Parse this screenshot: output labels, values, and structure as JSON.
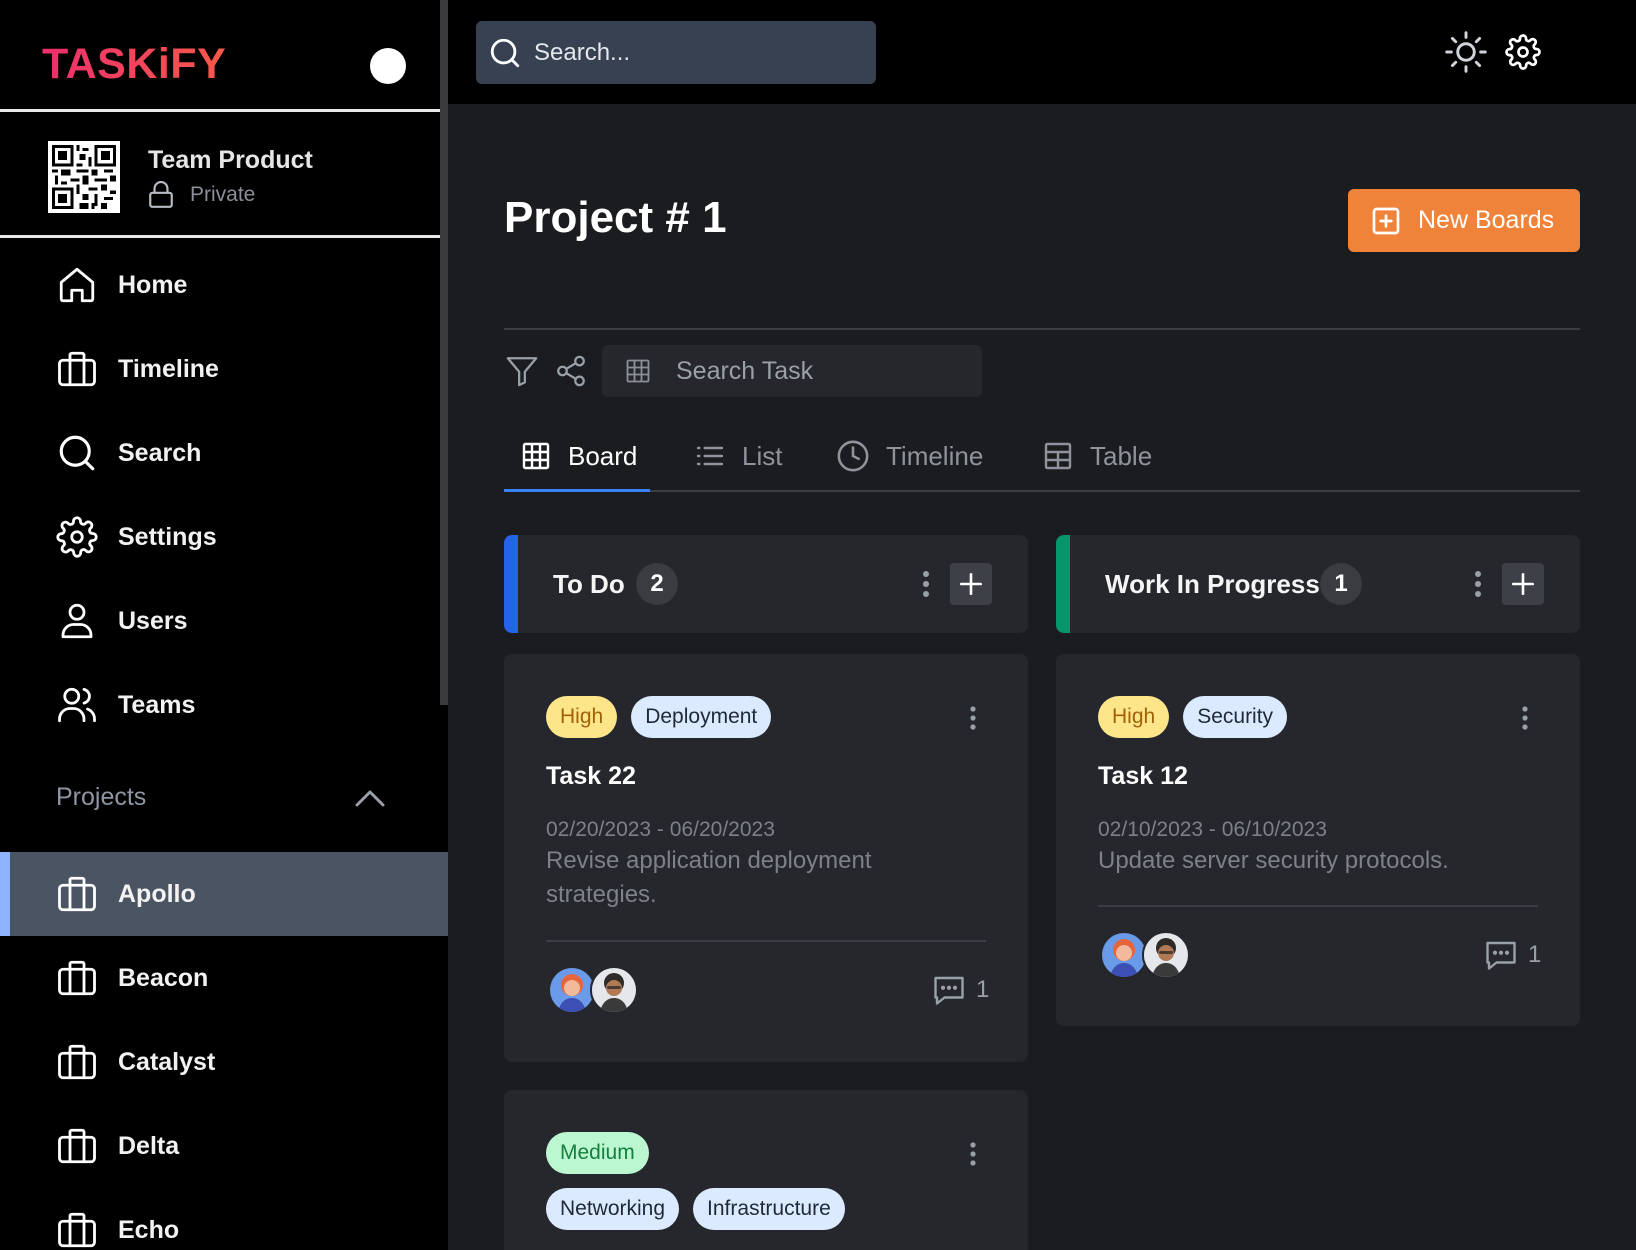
{
  "app": {
    "logo": "TASKiFY"
  },
  "team": {
    "name": "Team Product",
    "visibility": "Private"
  },
  "nav": [
    {
      "label": "Home",
      "icon": "home-icon"
    },
    {
      "label": "Timeline",
      "icon": "briefcase-icon"
    },
    {
      "label": "Search",
      "icon": "search-icon"
    },
    {
      "label": "Settings",
      "icon": "gear-icon"
    },
    {
      "label": "Users",
      "icon": "user-icon"
    },
    {
      "label": "Teams",
      "icon": "users-icon"
    }
  ],
  "projects": {
    "heading": "Projects",
    "items": [
      {
        "label": "Apollo",
        "active": true
      },
      {
        "label": "Beacon"
      },
      {
        "label": "Catalyst"
      },
      {
        "label": "Delta"
      },
      {
        "label": "Echo"
      }
    ]
  },
  "topbar": {
    "search_placeholder": "Search..."
  },
  "page": {
    "title": "Project # 1",
    "new_button": "New Boards",
    "task_search_placeholder": "Search Task",
    "tabs": [
      {
        "label": "Board",
        "active": true
      },
      {
        "label": "List"
      },
      {
        "label": "Timeline"
      },
      {
        "label": "Table"
      }
    ]
  },
  "columns": [
    {
      "title": "To Do",
      "count": "2",
      "color": "#2563eb"
    },
    {
      "title": "Work In Progress",
      "count": "1",
      "color": "#059669"
    }
  ],
  "cards": [
    {
      "priority": "High",
      "tags": [
        "Deployment"
      ],
      "title": "Task 22",
      "dates": "02/20/2023 - 06/20/2023",
      "description": "Revise application deployment strategies.",
      "comments": "1"
    },
    {
      "priority": "High",
      "tags": [
        "Security"
      ],
      "title": "Task 12",
      "dates": "02/10/2023 - 06/10/2023",
      "description": "Update server security protocols.",
      "comments": "1"
    },
    {
      "priority": "Medium",
      "tags": [
        "Networking",
        "Infrastructure"
      ]
    }
  ]
}
